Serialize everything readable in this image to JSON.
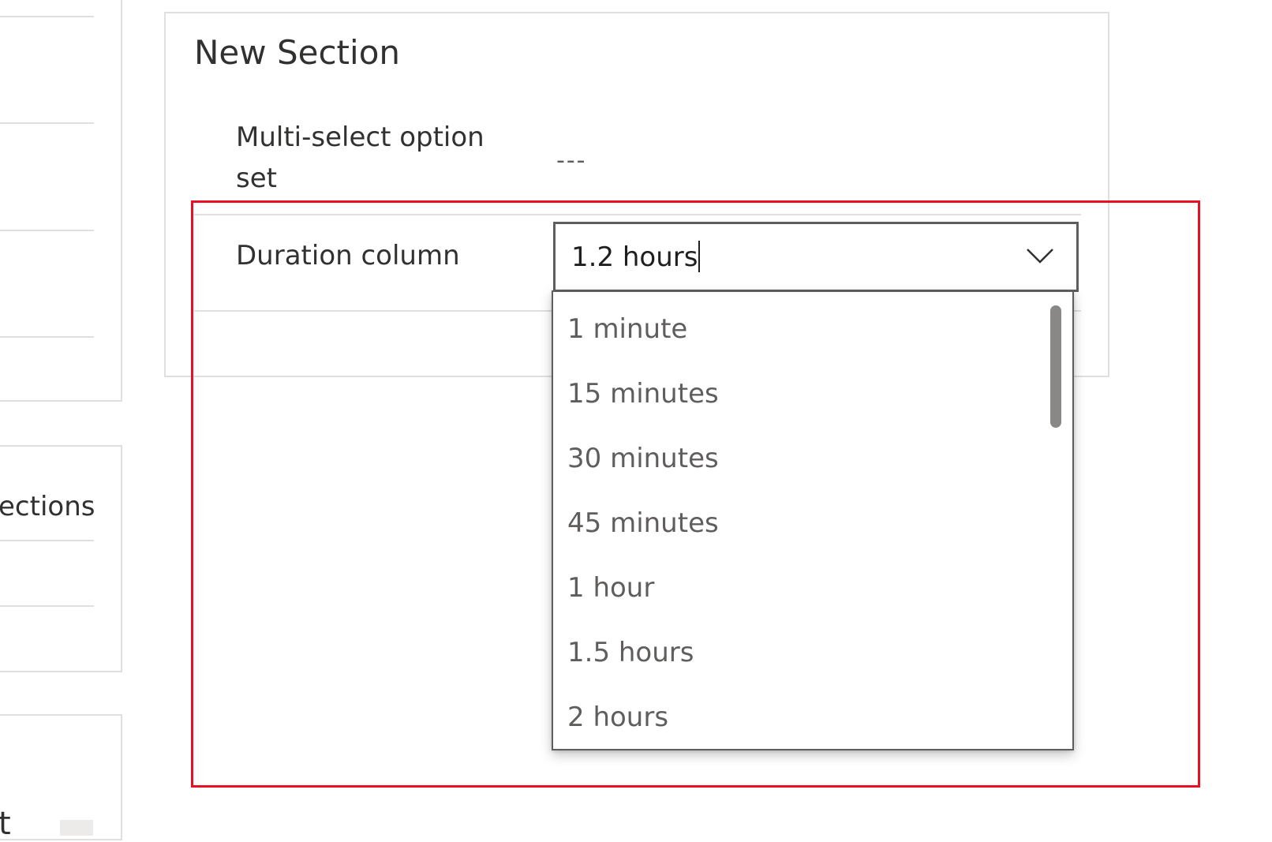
{
  "left": {
    "partial_label": "ections",
    "bottom_partial": "t"
  },
  "section": {
    "title": "New Section",
    "multi_select_label_line1": "Multi-select option",
    "multi_select_label_line2": "set",
    "multi_select_value": "---",
    "duration_label": "Duration column"
  },
  "duration_combo": {
    "value": "1.2 hours",
    "expanded": true,
    "options": [
      "1 minute",
      "15 minutes",
      "30 minutes",
      "45 minutes",
      "1 hour",
      "1.5 hours",
      "2 hours"
    ]
  },
  "colors": {
    "highlight": "#e81123",
    "border": "#e1dfdd",
    "combo_border": "#605e5c"
  }
}
